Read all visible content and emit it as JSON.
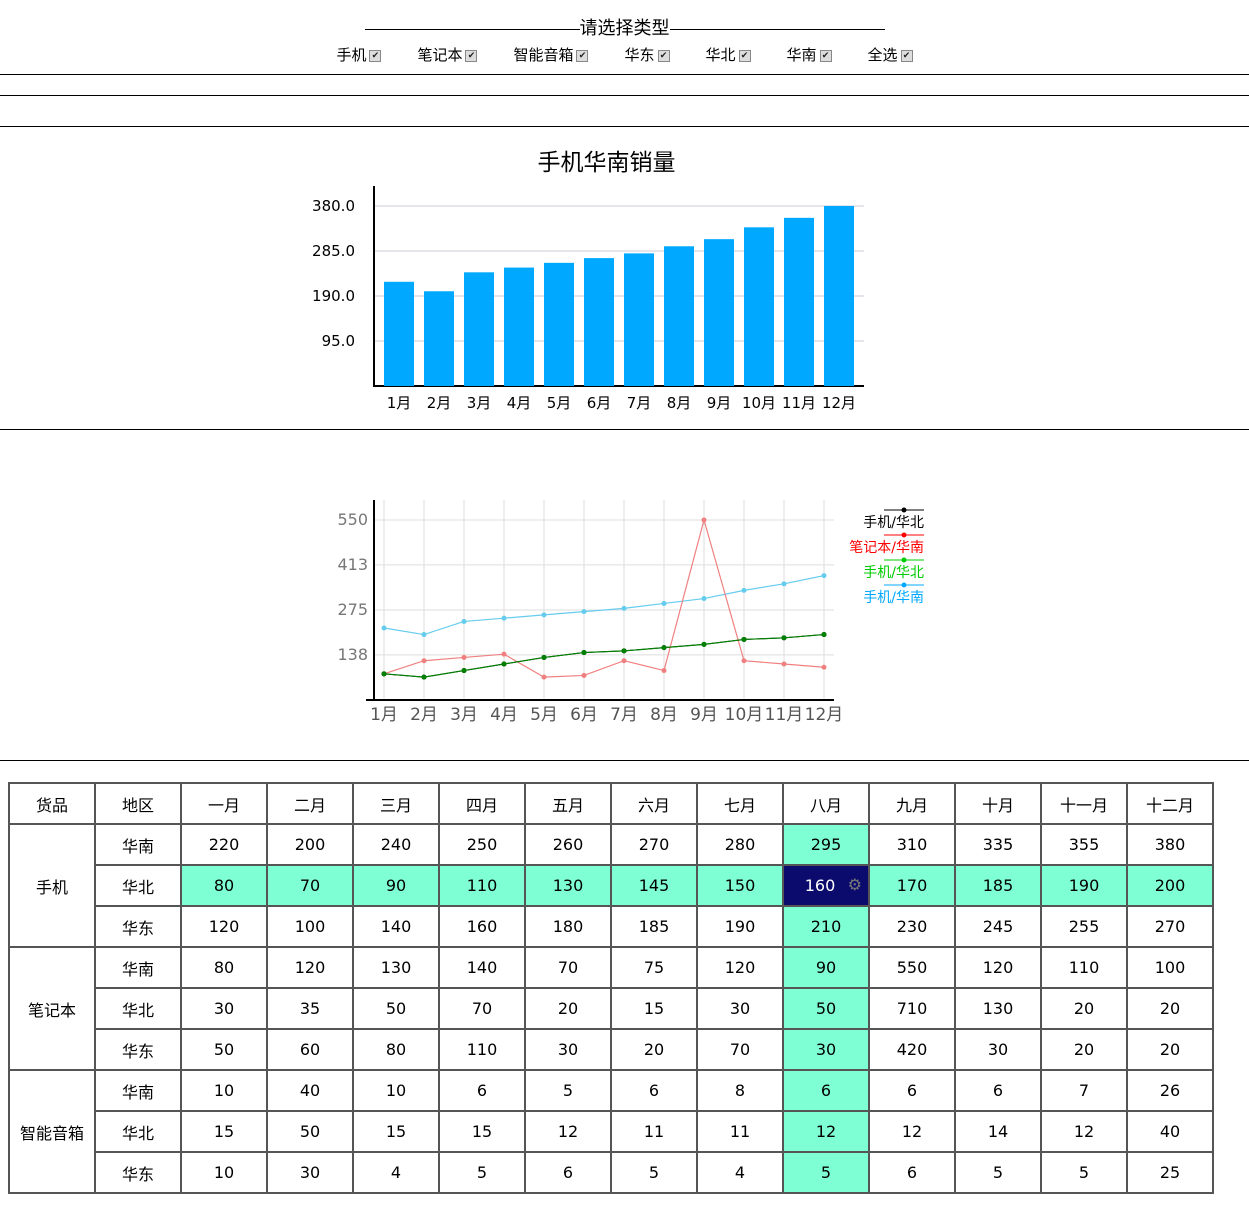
{
  "header": {
    "title": "请选择类型"
  },
  "filters": [
    {
      "label": "手机",
      "checked": true
    },
    {
      "label": "笔记本",
      "checked": true
    },
    {
      "label": "智能音箱",
      "checked": true
    },
    {
      "label": "华东",
      "checked": true
    },
    {
      "label": "华北",
      "checked": true
    },
    {
      "label": "华南",
      "checked": true
    },
    {
      "label": "全选",
      "checked": true
    }
  ],
  "chart_data": [
    {
      "type": "bar",
      "title": "手机华南销量",
      "categories": [
        "1月",
        "2月",
        "3月",
        "4月",
        "5月",
        "6月",
        "7月",
        "8月",
        "9月",
        "10月",
        "11月",
        "12月"
      ],
      "values": [
        220,
        200,
        240,
        250,
        260,
        270,
        280,
        295,
        310,
        335,
        355,
        380
      ],
      "yticks": [
        "95.0",
        "190.0",
        "285.0",
        "380.0"
      ],
      "ylim": [
        0,
        380
      ],
      "color": "#00a8ff",
      "grid": true
    },
    {
      "type": "line",
      "categories": [
        "1月",
        "2月",
        "3月",
        "4月",
        "5月",
        "6月",
        "7月",
        "8月",
        "9月",
        "10月",
        "11月",
        "12月"
      ],
      "yticks": [
        "138",
        "275",
        "413",
        "550"
      ],
      "ylim": [
        0,
        550
      ],
      "grid": true,
      "legend_position": "right",
      "series": [
        {
          "name": "手机/华北",
          "color": "#000000",
          "values": [
            80,
            70,
            90,
            110,
            130,
            145,
            150,
            160,
            170,
            185,
            190,
            200
          ]
        },
        {
          "name": "笔记本/华南",
          "color": "#ff0000",
          "values": [
            80,
            120,
            130,
            140,
            70,
            75,
            120,
            90,
            550,
            120,
            110,
            100
          ]
        },
        {
          "name": "手机/华北",
          "color": "#00cc00",
          "values": [
            80,
            70,
            90,
            110,
            130,
            145,
            150,
            160,
            170,
            185,
            190,
            200
          ]
        },
        {
          "name": "手机/华南",
          "color": "#00a8ff",
          "values": [
            220,
            200,
            240,
            250,
            260,
            270,
            280,
            295,
            310,
            335,
            355,
            380
          ]
        }
      ],
      "series_line_colors": [
        "#000000",
        "#f08080",
        "#008000",
        "#66ccee"
      ]
    }
  ],
  "table": {
    "headers": [
      "货品",
      "地区",
      "一月",
      "二月",
      "三月",
      "四月",
      "五月",
      "六月",
      "七月",
      "八月",
      "九月",
      "十月",
      "十一月",
      "十二月"
    ],
    "groups": [
      {
        "product": "手机",
        "rows": [
          {
            "region": "华南",
            "values": [
              220,
              200,
              240,
              250,
              260,
              270,
              280,
              295,
              310,
              335,
              355,
              380
            ]
          },
          {
            "region": "华北",
            "values": [
              80,
              70,
              90,
              110,
              130,
              145,
              150,
              160,
              170,
              185,
              190,
              200
            ]
          },
          {
            "region": "华东",
            "values": [
              120,
              100,
              140,
              160,
              180,
              185,
              190,
              210,
              230,
              245,
              255,
              270
            ]
          }
        ]
      },
      {
        "product": "笔记本",
        "rows": [
          {
            "region": "华南",
            "values": [
              80,
              120,
              130,
              140,
              70,
              75,
              120,
              90,
              550,
              120,
              110,
              100
            ]
          },
          {
            "region": "华北",
            "values": [
              30,
              35,
              50,
              70,
              20,
              15,
              30,
              50,
              710,
              130,
              20,
              20
            ]
          },
          {
            "region": "华东",
            "values": [
              50,
              60,
              80,
              110,
              30,
              20,
              70,
              30,
              420,
              30,
              20,
              20
            ]
          }
        ]
      },
      {
        "product": "智能音箱",
        "rows": [
          {
            "region": "华南",
            "values": [
              10,
              40,
              10,
              6,
              5,
              6,
              8,
              6,
              6,
              6,
              7,
              26
            ]
          },
          {
            "region": "华北",
            "values": [
              15,
              50,
              15,
              15,
              12,
              11,
              11,
              12,
              12,
              14,
              12,
              40
            ]
          },
          {
            "region": "华东",
            "values": [
              10,
              30,
              4,
              5,
              6,
              5,
              4,
              5,
              6,
              5,
              5,
              25
            ]
          }
        ]
      }
    ],
    "highlight_row": {
      "group": 0,
      "row": 1
    },
    "highlight_col": 7,
    "highlight_color": "#7fffd4",
    "selected_cell": {
      "group": 0,
      "row": 1,
      "col": 7,
      "color": "#0b0b6e",
      "icon": "gear-icon"
    }
  }
}
